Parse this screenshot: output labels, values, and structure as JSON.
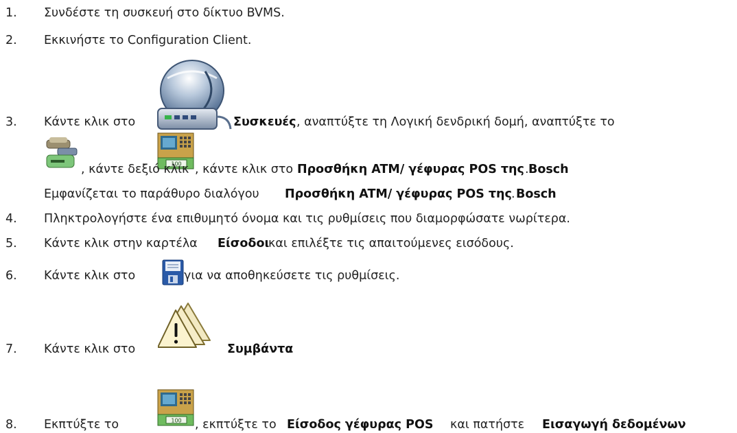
{
  "steps": [
    {
      "num": "1.",
      "text": "Συνδέστε τη συσκευή στο δίκτυο BVMS."
    },
    {
      "num": "2.",
      "text": "Εκκινήστε το Configuration Client."
    },
    {
      "num": "3.",
      "a": "Κάντε κλικ στο ",
      "b": "Συσκευές",
      "c": ", αναπτύξτε τη Λογική δενδρική δομή, αναπτύξτε το",
      "d": ", κάντε δεξιό κλικ ",
      "e": ", κάντε κλικ στο ",
      "f": "Προσθήκη ATM/ γέφυρας POS της Bosch",
      "g": ".",
      "h": "Εμφανίζεται το παράθυρο διαλόγου ",
      "i": "Προσθήκη ATM/ γέφυρας POS της Bosch",
      "j": "."
    },
    {
      "num": "4.",
      "text": "Πληκτρολογήστε ένα επιθυμητό όνομα και τις ρυθμίσεις που διαμορφώσατε νωρίτερα."
    },
    {
      "num": "5.",
      "a": "Κάντε κλικ στην καρτέλα ",
      "b": "Είσοδοι",
      "c": " και επιλέξτε τις απαιτούμενες εισόδους."
    },
    {
      "num": "6.",
      "a": "Κάντε κλικ στο ",
      "b": " για να αποθηκεύσετε τις ρυθμίσεις."
    },
    {
      "num": "7.",
      "a": "Κάντε κλικ στο",
      "b": "Συμβάντα",
      "c": "."
    },
    {
      "num": "8.",
      "a": "Εκπτύξτε το ",
      "b": ", εκπτύξτε το ",
      "c": "Είσοδος γέφυρας POS",
      "d": " και πατήστε ",
      "e": "Εισαγωγή δεδομένων"
    }
  ],
  "icons": [
    "devices-icon",
    "device-group-icon",
    "atm-pos-bridge-icon",
    "save-icon",
    "events-icon"
  ]
}
